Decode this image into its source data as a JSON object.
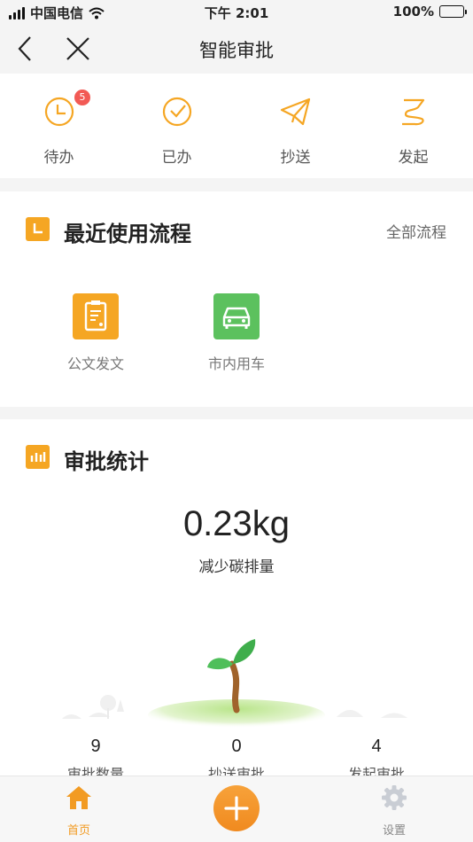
{
  "status_bar": {
    "carrier": "中国电信",
    "time": "下午 2:01",
    "battery": "100%"
  },
  "nav": {
    "title": "智能审批"
  },
  "quick_actions": [
    {
      "label": "待办",
      "icon": "clock-icon",
      "badge": "5"
    },
    {
      "label": "已办",
      "icon": "check-circle-icon"
    },
    {
      "label": "抄送",
      "icon": "paper-plane-icon"
    },
    {
      "label": "发起",
      "icon": "flag-icon"
    }
  ],
  "recent": {
    "title": "最近使用流程",
    "all_link": "全部流程",
    "items": [
      {
        "label": "公文发文",
        "icon": "document-icon",
        "color": "#f5a623"
      },
      {
        "label": "市内用车",
        "icon": "car-icon",
        "color": "#5cc15e"
      }
    ]
  },
  "stats": {
    "title": "审批统计",
    "carbon_value": "0.23kg",
    "carbon_label": "减少碳排量",
    "items": [
      {
        "value": "9",
        "label": "审批数量"
      },
      {
        "value": "0",
        "label": "抄送审批"
      },
      {
        "value": "4",
        "label": "发起审批"
      }
    ]
  },
  "tabs": [
    {
      "label": "首页",
      "icon": "home-icon",
      "active": true
    },
    {
      "label": "",
      "icon": "plus-icon"
    },
    {
      "label": "设置",
      "icon": "gear-icon"
    }
  ],
  "colors": {
    "accent": "#f5a623",
    "badge": "#f25a55",
    "green": "#5cc15e"
  }
}
